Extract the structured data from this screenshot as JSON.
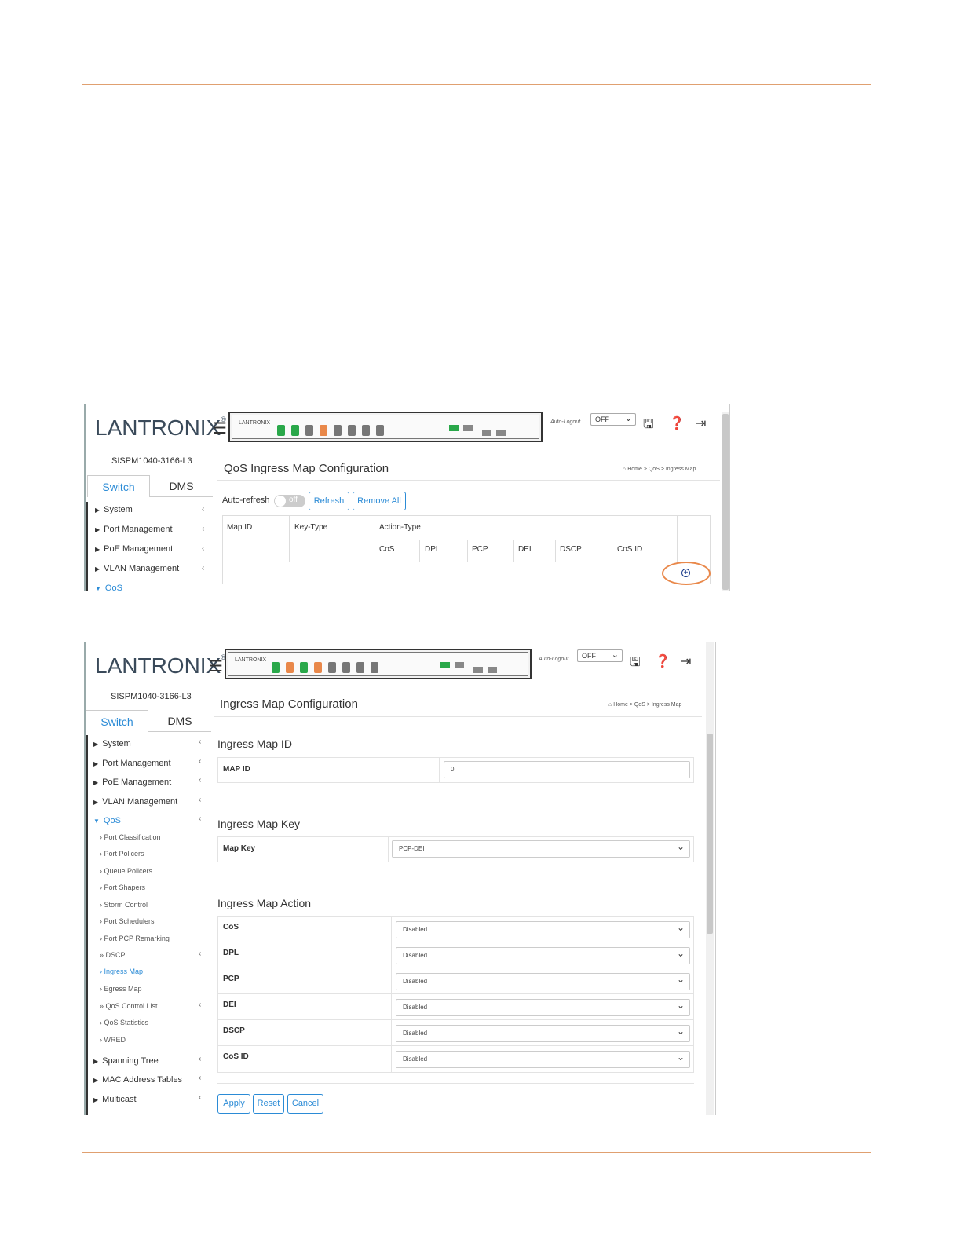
{
  "shot1": {
    "brand": "LANTRONIX",
    "panel_logo": "LANTRONIX",
    "auto_logout_label": "Auto-Logout",
    "auto_logout_value": "OFF",
    "model": "SISPM1040-3166-L3",
    "tabs": [
      "Switch",
      "DMS"
    ],
    "sidebar": [
      "System",
      "Port Management",
      "PoE Management",
      "VLAN Management",
      "QoS"
    ],
    "title": "QoS Ingress Map Configuration",
    "breadcrumb": [
      "Home",
      "QoS",
      "Ingress Map"
    ],
    "auto_refresh_label": "Auto-refresh",
    "toggle_state": "off",
    "buttons": [
      "Refresh",
      "Remove All"
    ],
    "table": {
      "headers": [
        "Map ID",
        "Key-Type",
        "Action-Type"
      ],
      "action_cols": [
        "CoS",
        "DPL",
        "PCP",
        "DEI",
        "DSCP",
        "CoS ID"
      ]
    }
  },
  "shot2": {
    "brand": "LANTRONIX",
    "panel_logo": "LANTRONIX",
    "auto_logout_label": "Auto-Logout",
    "auto_logout_value": "OFF",
    "model": "SISPM1040-3166-L3",
    "tabs": [
      "Switch",
      "DMS"
    ],
    "sidebar_top": [
      "System",
      "Port Management",
      "PoE Management",
      "VLAN Management",
      "QoS"
    ],
    "qos_sub": [
      "Port Classification",
      "Port Policers",
      "Queue Policers",
      "Port Shapers",
      "Storm Control",
      "Port Schedulers",
      "Port PCP Remarking",
      "DSCP",
      "Ingress Map",
      "Egress Map",
      "QoS Control List",
      "QoS Statistics",
      "WRED"
    ],
    "sidebar_bottom": [
      "Spanning Tree",
      "MAC Address Tables",
      "Multicast"
    ],
    "title": "Ingress Map Configuration",
    "breadcrumb": [
      "Home",
      "QoS",
      "Ingress Map"
    ],
    "section_id": "Ingress Map ID",
    "map_id_label": "MAP ID",
    "map_id_value": "0",
    "section_key": "Ingress Map Key",
    "map_key_label": "Map Key",
    "map_key_value": "PCP-DEI",
    "section_action": "Ingress Map Action",
    "actions": [
      {
        "label": "CoS",
        "value": "Disabled"
      },
      {
        "label": "DPL",
        "value": "Disabled"
      },
      {
        "label": "PCP",
        "value": "Disabled"
      },
      {
        "label": "DEI",
        "value": "Disabled"
      },
      {
        "label": "DSCP",
        "value": "Disabled"
      },
      {
        "label": "CoS ID",
        "value": "Disabled"
      }
    ],
    "buttons": [
      "Apply",
      "Reset",
      "Cancel"
    ]
  },
  "colors": {
    "accent": "#2b8bd6",
    "brand_orange": "#e06a2a",
    "port_green": "#2aa84a",
    "port_orange": "#e9884a"
  }
}
